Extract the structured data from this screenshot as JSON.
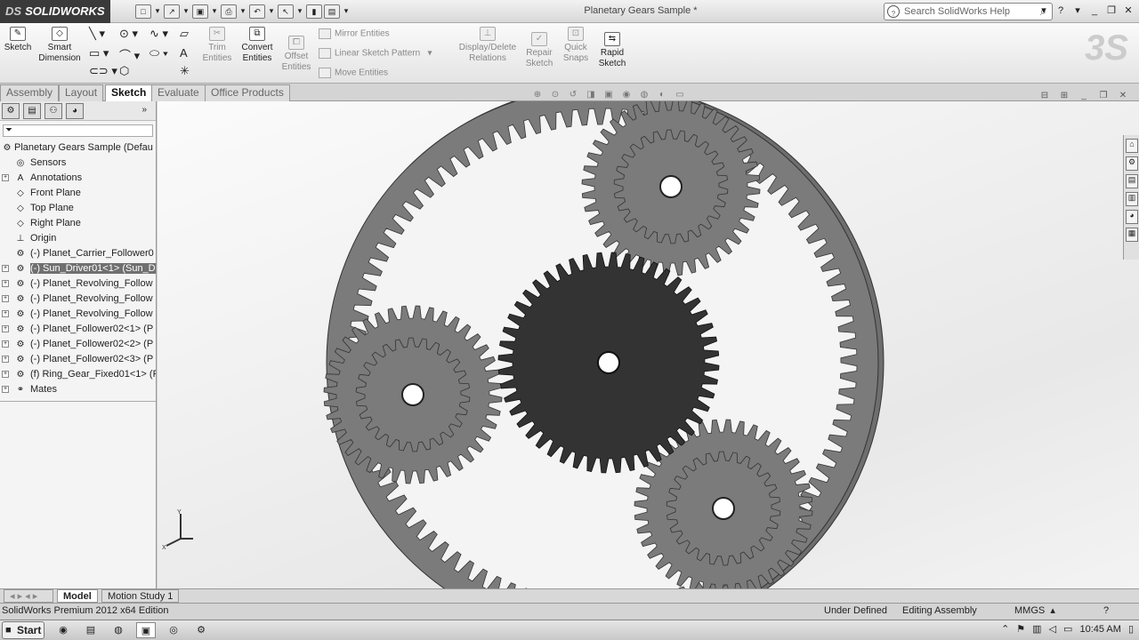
{
  "app": {
    "logo": "SOLIDWORKS",
    "logo_prefix": "DS",
    "title": "Planetary Gears Sample *"
  },
  "search": {
    "placeholder": "Search SolidWorks Help"
  },
  "ribbon": {
    "sketch": "Sketch",
    "smart_dimension": "Smart Dimension",
    "trim_entities": "Trim Entities",
    "convert_entities": "Convert Entities",
    "offset_entities": "Offset Entities",
    "mirror_entities": "Mirror Entities",
    "linear_sketch_pattern": "Linear Sketch Pattern",
    "move_entities": "Move Entities",
    "display_delete_relations": "Display/Delete Relations",
    "repair_sketch": "Repair Sketch",
    "quick_snaps": "Quick Snaps",
    "rapid_sketch": "Rapid Sketch"
  },
  "tabs": [
    "Assembly",
    "Layout",
    "Sketch",
    "Evaluate",
    "Office Products"
  ],
  "active_tab": "Sketch",
  "tree": {
    "root": "Planetary Gears Sample  (Defau",
    "items": [
      {
        "label": "Sensors",
        "icon": "sensor-icon",
        "expand": false
      },
      {
        "label": "Annotations",
        "icon": "annotation-icon",
        "expand": true
      },
      {
        "label": "Front Plane",
        "icon": "plane-icon",
        "expand": false
      },
      {
        "label": "Top Plane",
        "icon": "plane-icon",
        "expand": false
      },
      {
        "label": "Right Plane",
        "icon": "plane-icon",
        "expand": false
      },
      {
        "label": "Origin",
        "icon": "origin-icon",
        "expand": false
      },
      {
        "label": "(-) Planet_Carrier_Follower0",
        "icon": "part-icon",
        "expand": false
      },
      {
        "label": "(-) Sun_Driver01<1> (Sun_D",
        "icon": "part-icon",
        "expand": true,
        "selected": true
      },
      {
        "label": "(-) Planet_Revolving_Follow",
        "icon": "part-icon",
        "expand": true
      },
      {
        "label": "(-) Planet_Revolving_Follow",
        "icon": "part-icon",
        "expand": true
      },
      {
        "label": "(-) Planet_Revolving_Follow",
        "icon": "part-icon",
        "expand": true
      },
      {
        "label": "(-) Planet_Follower02<1> (P",
        "icon": "part-icon",
        "expand": true
      },
      {
        "label": "(-) Planet_Follower02<2> (P",
        "icon": "part-icon",
        "expand": true
      },
      {
        "label": "(-) Planet_Follower02<3> (P",
        "icon": "part-icon",
        "expand": true
      },
      {
        "label": "(f) Ring_Gear_Fixed01<1> (R",
        "icon": "part-icon",
        "expand": true
      },
      {
        "label": "Mates",
        "icon": "mates-icon",
        "expand": true
      }
    ]
  },
  "bottom_tabs": [
    "Model",
    "Motion Study 1"
  ],
  "status": {
    "edition": "SolidWorks Premium 2012 x64 Edition",
    "sketch_state": "Under Defined",
    "mode": "Editing Assembly",
    "units": "MMGS"
  },
  "taskbar": {
    "start": "Start",
    "time": "10:45 AM"
  },
  "colors": {
    "gear_gray": "#7b7b7b",
    "sun_dark": "#333333",
    "viewport_bg": "#f4f4f4"
  }
}
